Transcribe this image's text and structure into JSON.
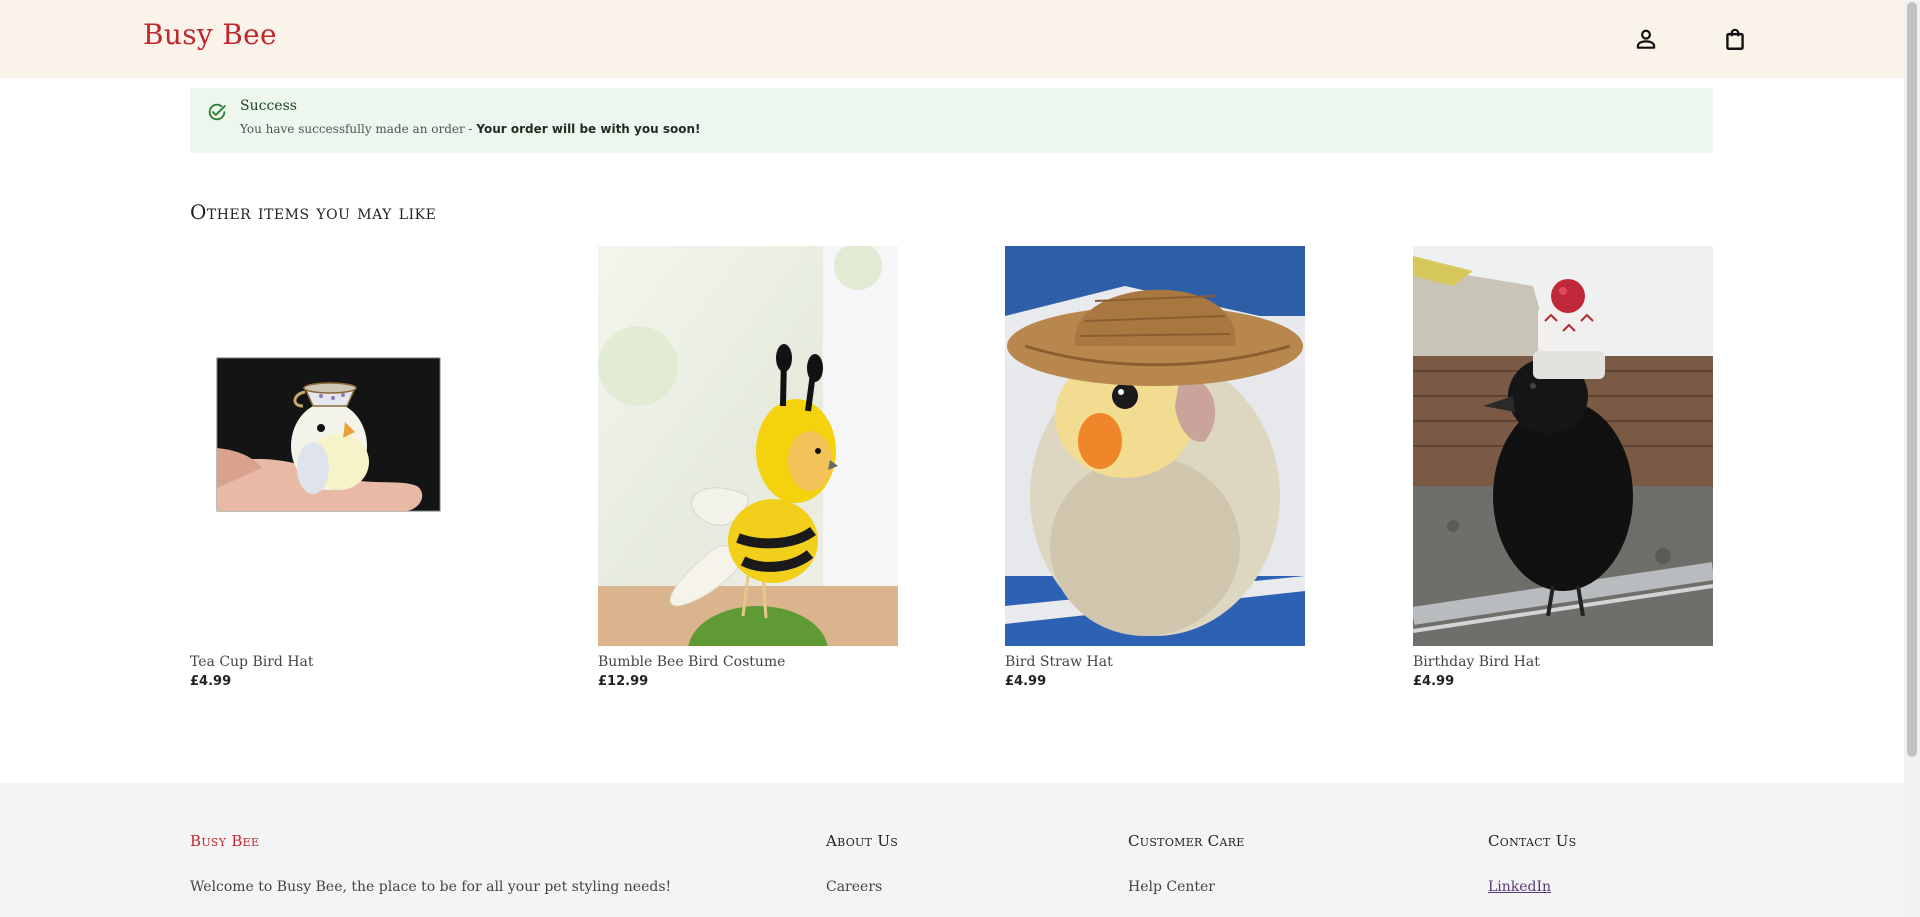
{
  "header": {
    "brand": "Busy Bee",
    "icons": [
      "account-icon",
      "shopping-bag-icon"
    ]
  },
  "alert": {
    "title": "Success",
    "message": "You have successfully made an order - ",
    "message_strong": "Your order will be with you soon!",
    "color": "#edf7ed"
  },
  "section": {
    "title": "Other items you may like"
  },
  "products": [
    {
      "name": "Tea Cup Bird Hat",
      "price": "£4.99"
    },
    {
      "name": "Bumble Bee Bird Costume",
      "price": "£12.99"
    },
    {
      "name": "Bird Straw Hat",
      "price": "£4.99"
    },
    {
      "name": "Birthday Bird Hat",
      "price": "£4.99"
    }
  ],
  "footer": {
    "brand": "Busy Bee",
    "tagline": "Welcome to Busy Bee, the place to be for all your pet styling needs!",
    "about": {
      "heading": "About Us",
      "link": "Careers"
    },
    "care": {
      "heading": "Customer Care",
      "link": "Help Center"
    },
    "contact": {
      "heading": "Contact Us",
      "link": "LinkedIn"
    }
  },
  "colors": {
    "brand": "#c0272d",
    "header_bg": "#f9f3ea",
    "footer_bg": "#f4f4f4"
  }
}
